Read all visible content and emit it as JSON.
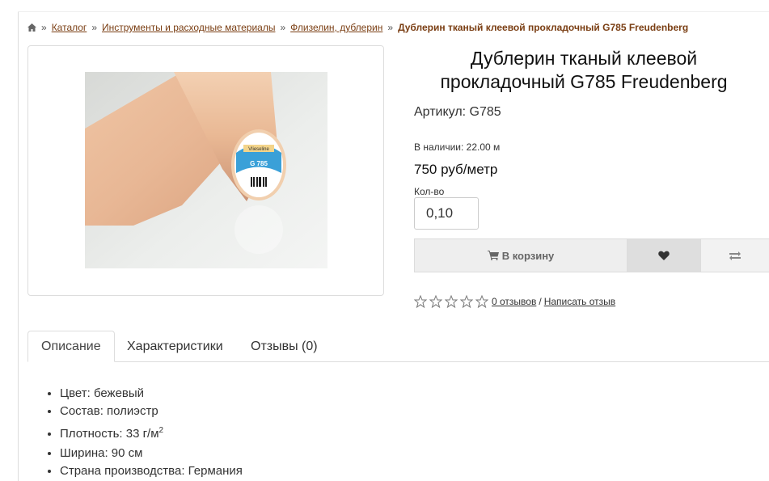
{
  "breadcrumb": {
    "items": [
      "Каталог",
      "Инструменты и расходные материалы",
      "Флизелин, дублерин"
    ],
    "current": "Дублерин тканый клеевой прокладочный G785 Freudenberg",
    "separator": "»"
  },
  "product": {
    "title": "Дублерин тканый клеевой прокладочный G785 Freudenberg",
    "sku": "Артикул: G785",
    "stock": "В наличии: 22.00 м",
    "price": "750 руб/метр",
    "qty_label": "Кол-во",
    "qty_value": "0,10",
    "image_label": "G 785",
    "image_brand": "Vlieseline"
  },
  "actions": {
    "cart_label": "В корзину",
    "wishlist_icon": "heart-icon",
    "compare_icon": "exchange-icon"
  },
  "rating": {
    "stars": 0,
    "reviews_link": "0 отзывов",
    "separator": "/",
    "write_link": "Написать отзыв"
  },
  "tabs": [
    {
      "label": "Описание",
      "active": true
    },
    {
      "label": "Характеристики",
      "active": false
    },
    {
      "label": "Отзывы (0)",
      "active": false
    }
  ],
  "description": {
    "color": "Цвет: бежевый",
    "composition": "Состав: полиэстр",
    "density": "Плотность: 33 г/м",
    "density_sup": "2",
    "width": "Ширина: 90 см",
    "country": "Страна производства: Германия"
  },
  "colors": {
    "link": "#7a3e13",
    "cart_bg": "#eeeeee",
    "wish_bg": "#dedede",
    "fabric": "#e8b795",
    "label_blue": "#3aa0d8"
  }
}
